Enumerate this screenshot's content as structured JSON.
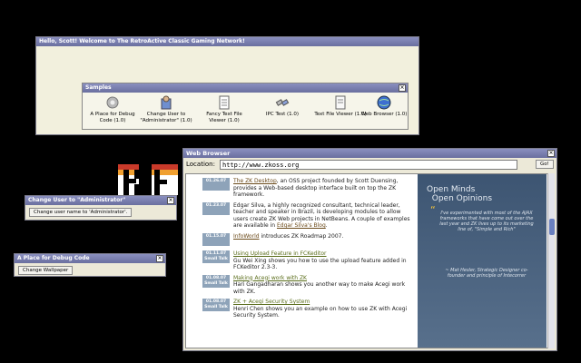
{
  "main_window": {
    "title": "Hello, Scott! Welcome to The RetroActive Classic Gaming Network!"
  },
  "samples": {
    "title": "Samples",
    "items": [
      {
        "label": "A Place for Debug Code (1.0)",
        "icon": "gear-icon"
      },
      {
        "label": "Change User to \"Administrator\" (1.0)",
        "icon": "user-icon"
      },
      {
        "label": "Fancy Text File Viewer (1.0)",
        "icon": "document-icon"
      },
      {
        "label": "IPC Test (1.0)",
        "icon": "connector-icon"
      },
      {
        "label": "Text File Viewer (1.0)",
        "icon": "text-file-icon"
      },
      {
        "label": "Web Browser (1.0)",
        "icon": "globe-icon"
      }
    ]
  },
  "logo": {
    "text": "RE"
  },
  "change_user_window": {
    "title": "Change User to \"Administrator\"",
    "button": "Change user name to 'Administrator'."
  },
  "debug_window": {
    "title": "A Place for Debug Code",
    "button": "Change Wallpaper"
  },
  "browser": {
    "title": "Web Browser",
    "location_label": "Location:",
    "url": "http://www.zkoss.org",
    "go_label": "Go!",
    "news": [
      {
        "date": "01.26.07",
        "link": "The ZK Desktop",
        "text": ", an OSS project founded by Scott Duensing, provides a Web-based desktop interface built on top the ZK framework."
      },
      {
        "date": "01.23.07",
        "pre": "Edgar Silva, a highly recognized consultant, technical leader, teacher and speaker in Brazil, is developing modules to allow users create ZK Web projects in NetBeans. A couple of examples are available in ",
        "link": "Edgar Silva's Blog",
        "post": "."
      },
      {
        "date": "01.15.07",
        "link": "InfoWorld",
        "text": " introduces ZK Roadmap 2007."
      },
      {
        "date": "01.11.07",
        "sub": "Small Talk",
        "link": "Using Upload Feature in FCKeditor",
        "text": "Gu Wei Xing shows you how to use the upload feature added in FCKeditor 2.3-3."
      },
      {
        "date": "01.08.07",
        "sub": "Small Talk",
        "link": "Making Acegi work with ZK",
        "text": "Hari Gangadharan shows you another way to make Acegi work with ZK."
      },
      {
        "date": "01.08.07",
        "sub": "Small Talk",
        "link": "ZK + Acegi Security System",
        "text": "Henri Chen shows you an example on how to use ZK with Acegi Security System."
      }
    ],
    "panel": {
      "heading1": "Open Minds",
      "heading2": "Open Opinions",
      "quote": "I've experimented with most of the AJAX frameworks that have come out over the last year and ZK lives up to its marketing line of, \"Simple and Rich\"",
      "author": "~ Mat Hesler, Strategic Designer co-founder and principle of Intecorrer"
    }
  }
}
